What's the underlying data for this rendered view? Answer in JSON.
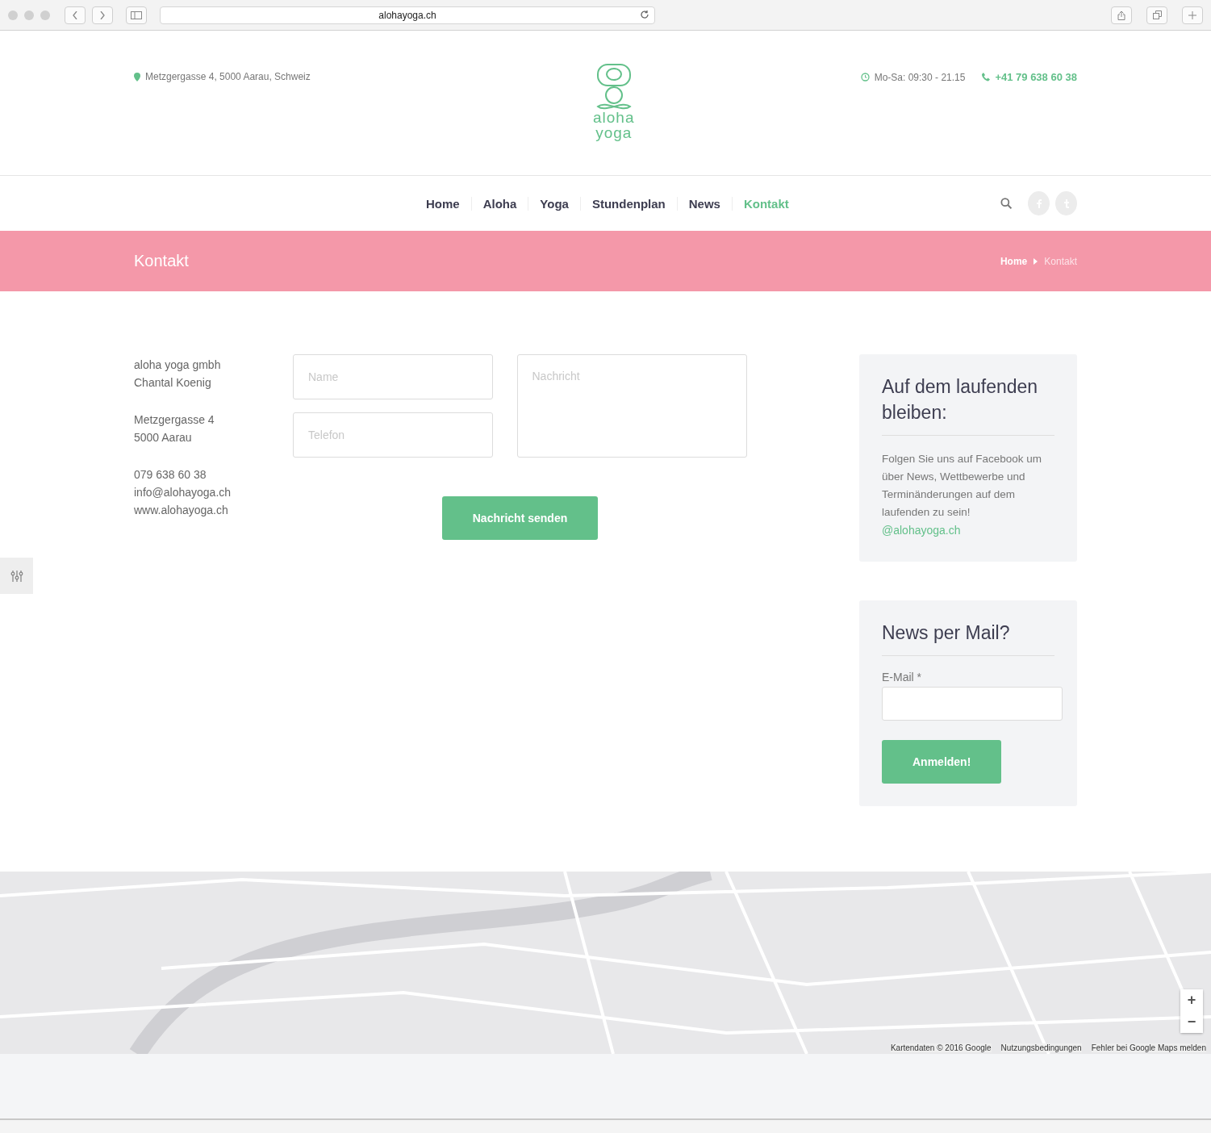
{
  "browser": {
    "url": "alohayoga.ch"
  },
  "header": {
    "address": "Metzgergasse 4, 5000 Aarau, Schweiz",
    "logo": {
      "line_1": "aloha",
      "line_2": "yoga"
    },
    "hours": "Mo-Sa: 09:30 - 21.15",
    "phone": "+41 79 638 60 38"
  },
  "nav": {
    "items": [
      {
        "label": "Home",
        "selected": false
      },
      {
        "label": "Aloha",
        "selected": false
      },
      {
        "label": "Yoga",
        "selected": false
      },
      {
        "label": "Stundenplan",
        "selected": false
      },
      {
        "label": "News",
        "selected": false
      },
      {
        "label": "Kontakt",
        "selected": true
      }
    ]
  },
  "banner": {
    "title": "Kontakt",
    "breadcrumb": [
      "Home",
      "Kontakt"
    ]
  },
  "contact": {
    "blocks": [
      [
        "aloha yoga gmbh",
        "Chantal Koenig"
      ],
      [
        "Metzgergasse 4",
        "5000 Aarau"
      ],
      [
        "079 638 60 38",
        "info@alohayoga.ch",
        "www.alohayoga.ch"
      ]
    ]
  },
  "form": {
    "name_placeholder": "Name",
    "phone_placeholder": "Telefon",
    "message_placeholder": "Nachricht",
    "submit": "Nachricht senden"
  },
  "sidebar": {
    "follow": {
      "title": "Auf dem laufenden bleiben:",
      "text": "Folgen Sie uns auf Facebook um über News, Wettbewerbe und Terminänderungen auf dem laufenden zu sein!",
      "link": "@alohayoga.ch"
    },
    "newsletter": {
      "title": "News per Mail?",
      "label": "E-Mail",
      "required": "*",
      "button": "Anmelden!"
    }
  },
  "map": {
    "attribution": [
      "Kartendaten © 2016 Google",
      "Nutzungsbedingungen",
      "Fehler bei Google Maps melden"
    ],
    "zoom_in": "+",
    "zoom_out": "−"
  }
}
